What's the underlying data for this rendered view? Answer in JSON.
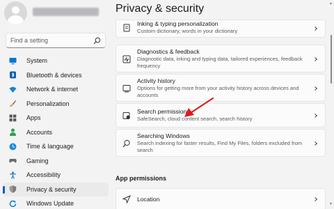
{
  "sidebar": {
    "search_placeholder": "Find a setting",
    "items": [
      {
        "label": "System",
        "icon": "monitor-icon"
      },
      {
        "label": "Bluetooth & devices",
        "icon": "bluetooth-icon"
      },
      {
        "label": "Network & internet",
        "icon": "wifi-icon"
      },
      {
        "label": "Personalization",
        "icon": "brush-icon"
      },
      {
        "label": "Apps",
        "icon": "apps-icon"
      },
      {
        "label": "Accounts",
        "icon": "person-icon"
      },
      {
        "label": "Time & language",
        "icon": "globe-clock-icon"
      },
      {
        "label": "Gaming",
        "icon": "gamepad-icon"
      },
      {
        "label": "Accessibility",
        "icon": "accessibility-icon"
      },
      {
        "label": "Privacy & security",
        "icon": "shield-icon"
      },
      {
        "label": "Windows Update",
        "icon": "update-icon"
      }
    ],
    "active_index": 9
  },
  "page": {
    "title": "Privacy & security"
  },
  "main": {
    "cards": [
      {
        "title": "Inking & typing personalization",
        "subtitle": "Custom dictionary, words in your dictionary",
        "icon": "notebook-icon"
      },
      {
        "title": "Diagnostics & feedback",
        "subtitle": "Diagnostic data, inking and typing data, tailored experiences, feedback frequency",
        "icon": "diagnostics-icon"
      },
      {
        "title": "Activity history",
        "subtitle": "Options for getting more from your activity history across devices and accounts",
        "icon": "history-icon"
      },
      {
        "title": "Search permissions",
        "subtitle": "SafeSearch, cloud content search, search history",
        "icon": "search-permissions-icon"
      },
      {
        "title": "Searching Windows",
        "subtitle": "Search indexing for faster results, Find My Files, folders excluded from search",
        "icon": "search-icon"
      }
    ],
    "section_title": "App permissions",
    "app_permissions": [
      {
        "title": "Location",
        "icon": "location-icon"
      }
    ]
  },
  "colors": {
    "accent": "#005fb8",
    "annotation_arrow": "#e0191b"
  }
}
